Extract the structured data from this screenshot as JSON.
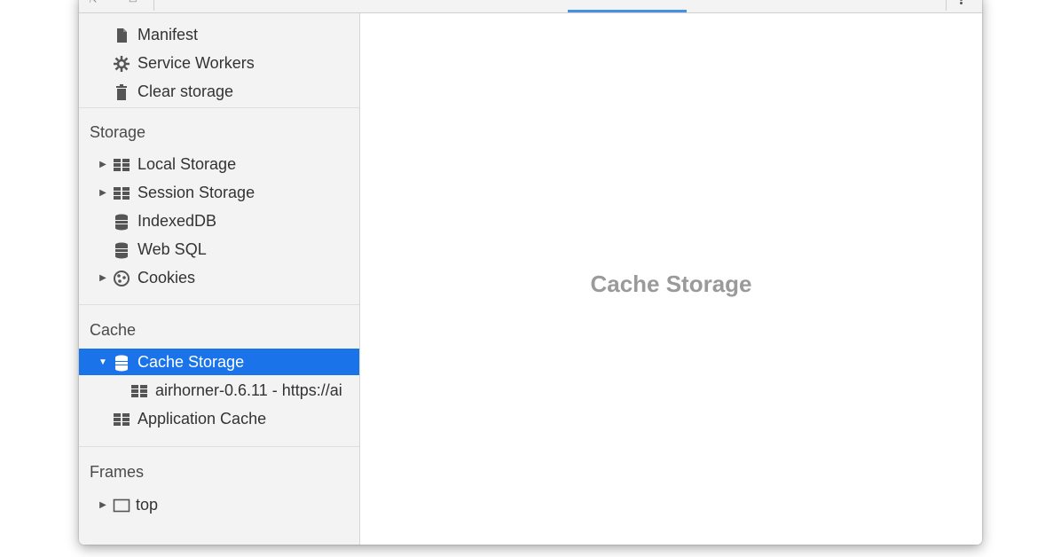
{
  "sidebar": {
    "application_items": [
      {
        "label": "Manifest",
        "icon": "file-icon"
      },
      {
        "label": "Service Workers",
        "icon": "gear-icon"
      },
      {
        "label": "Clear storage",
        "icon": "trash-icon"
      }
    ],
    "storage": {
      "header": "Storage",
      "items": [
        {
          "label": "Local Storage",
          "icon": "grid-icon",
          "expandable": true
        },
        {
          "label": "Session Storage",
          "icon": "grid-icon",
          "expandable": true
        },
        {
          "label": "IndexedDB",
          "icon": "database-icon",
          "expandable": false
        },
        {
          "label": "Web SQL",
          "icon": "database-icon",
          "expandable": false
        },
        {
          "label": "Cookies",
          "icon": "cookie-icon",
          "expandable": true
        }
      ]
    },
    "cache": {
      "header": "Cache",
      "items": [
        {
          "label": "Cache Storage",
          "icon": "database-icon",
          "expanded": true,
          "selected": true
        },
        {
          "label": "airhorner-0.6.11 - https://ai",
          "icon": "grid-icon",
          "child": true
        },
        {
          "label": "Application Cache",
          "icon": "grid-icon"
        }
      ]
    },
    "frames": {
      "header": "Frames",
      "items": [
        {
          "label": "top",
          "icon": "frame-icon",
          "expandable": true
        }
      ]
    }
  },
  "main": {
    "title": "Cache Storage"
  },
  "colors": {
    "selection": "#1a73e8",
    "sidebar_bg": "#f3f3f3",
    "main_title": "#9a9a9a"
  }
}
